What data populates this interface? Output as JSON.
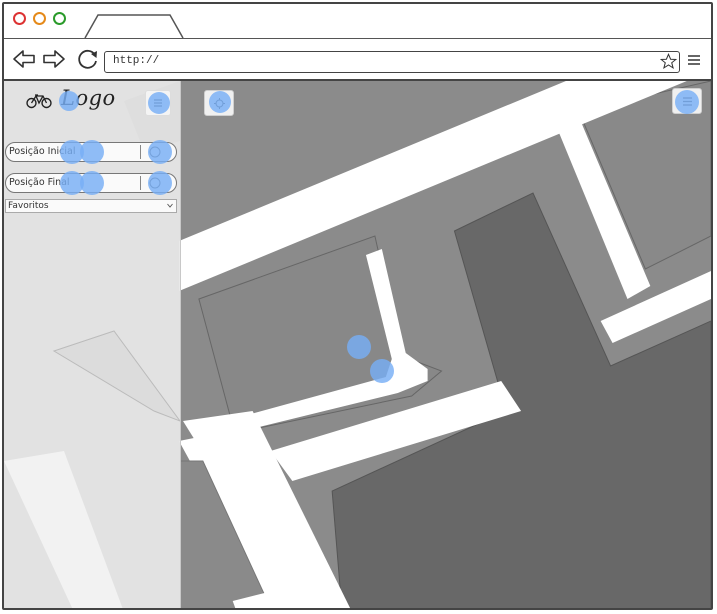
{
  "browser": {
    "url": "http://"
  },
  "sidebar": {
    "logo_text": "Logo",
    "start_placeholder": "Posição Inicial",
    "end_placeholder": "Posição Final",
    "favorites_label": "Favoritos"
  },
  "icons": {
    "bike": "bicycle-icon",
    "menu": "hamburger-menu-icon",
    "locate": "locate-icon",
    "favorite": "star-icon",
    "back": "back-arrow-icon",
    "forward": "forward-arrow-icon",
    "reload": "reload-icon"
  },
  "colors": {
    "map_block": "#8a8a8a",
    "map_dark": "#676767",
    "map_road": "#ffffff",
    "sidebar_bg": "#e8e8e8",
    "hotspot": "#78aff5"
  }
}
